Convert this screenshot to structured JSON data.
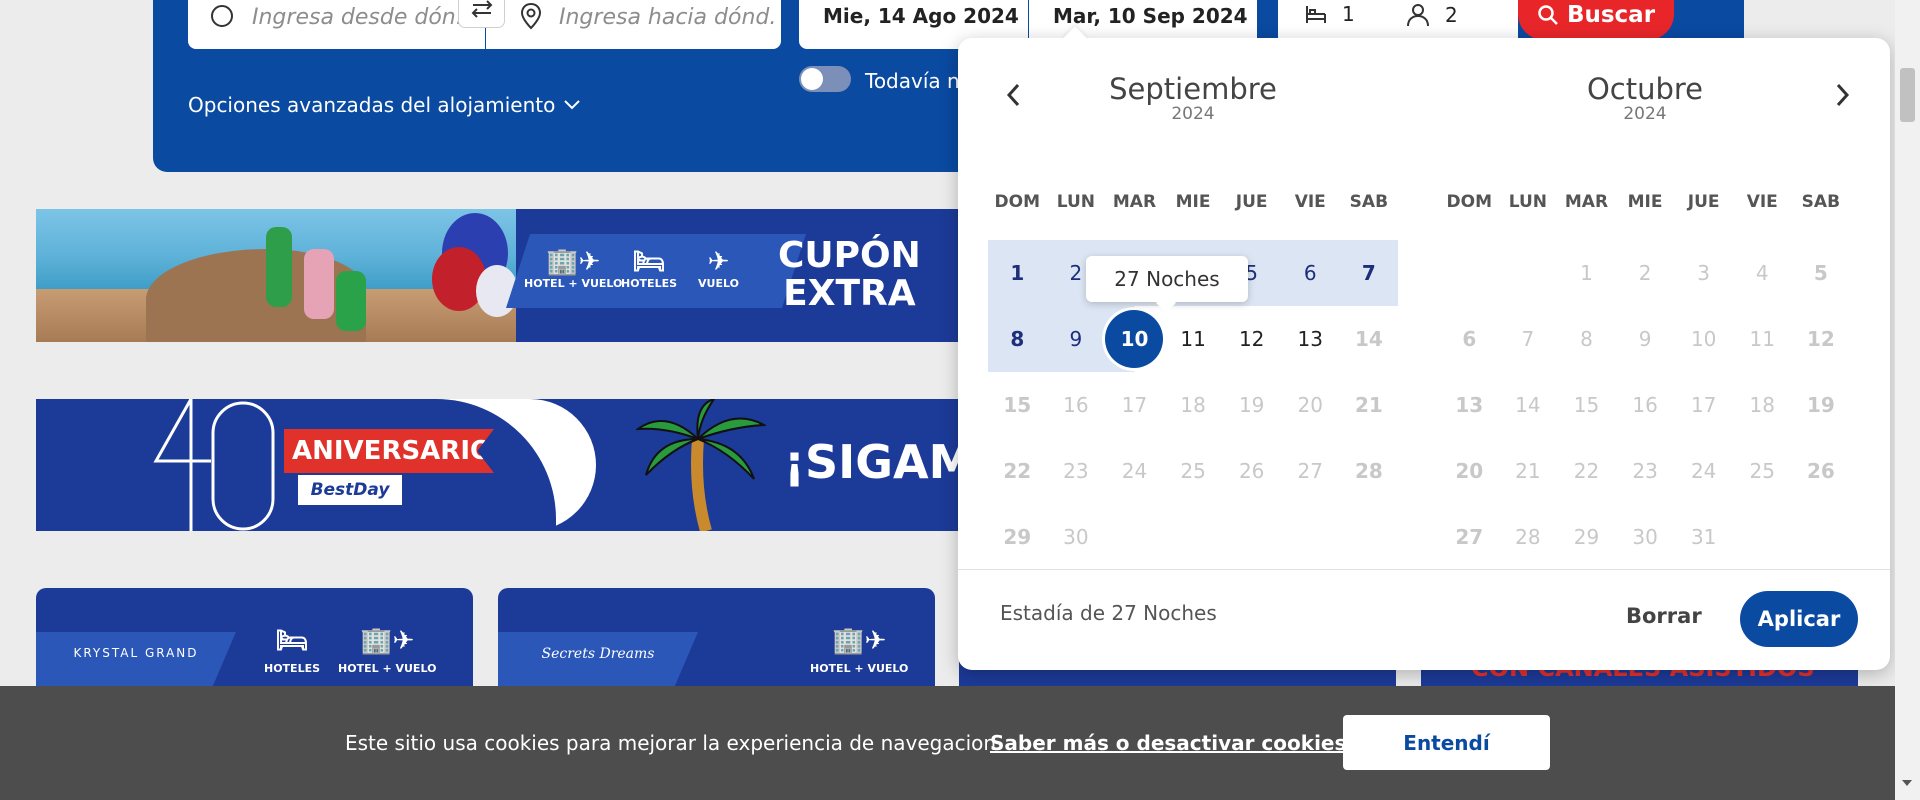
{
  "search": {
    "origin_placeholder": "Ingresa desde dónde sales",
    "origin_visible": "Ingresa desde dón...",
    "destination_visible": "Ingresa hacia dónd...",
    "date_from": "Mie, 14 Ago 2024",
    "date_to": "Mar, 10 Sep 2024",
    "rooms": "1",
    "guests": "2",
    "search_button": "Buscar",
    "advanced_options": "Opciones avanzadas del alojamiento",
    "toggle_label": "Todavía n"
  },
  "banners": {
    "promo": {
      "icons": [
        "HOTEL + VUELO",
        "HOTELES",
        "VUELO"
      ],
      "cupon_line1": "CUPÓN",
      "cupon_line2": "EXTRA"
    },
    "anniversary": {
      "ribbon": "ANIVERSARIO",
      "brand": "BestDay",
      "headline": "¡SIGAMOS"
    },
    "cards": [
      {
        "brand": "KRYSTAL GRAND",
        "icons": [
          "HOTELES",
          "HOTEL + VUELO"
        ]
      },
      {
        "brand": "Secrets Dreams",
        "icons": [
          "HOTEL + VUELO"
        ]
      },
      {
        "text": ""
      },
      {
        "text": "CON CANALES ASISTIDOS"
      }
    ]
  },
  "datepicker": {
    "weekdays": [
      "DOM",
      "LUN",
      "MAR",
      "MIE",
      "JUE",
      "VIE",
      "SAB"
    ],
    "left_month": {
      "name": "Septiembre",
      "year": "2024"
    },
    "right_month": {
      "name": "Octubre",
      "year": "2024"
    },
    "tooltip": "27 Noches",
    "stay_text": "Estadía de 27 Noches",
    "clear_button": "Borrar",
    "apply_button": "Aplicar",
    "selected_day": "10"
  },
  "cookies": {
    "text": "Este sitio usa cookies para mejorar la experiencia de navegacion.",
    "link": "Saber más o desactivar cookies.",
    "button": "Entendí"
  },
  "colors": {
    "primary": "#0a4aa1",
    "banner_blue": "#1c3a98",
    "accent_red": "#e8262a",
    "range_bg": "#dce5f3",
    "cookie_bg": "#4d4d4d"
  }
}
